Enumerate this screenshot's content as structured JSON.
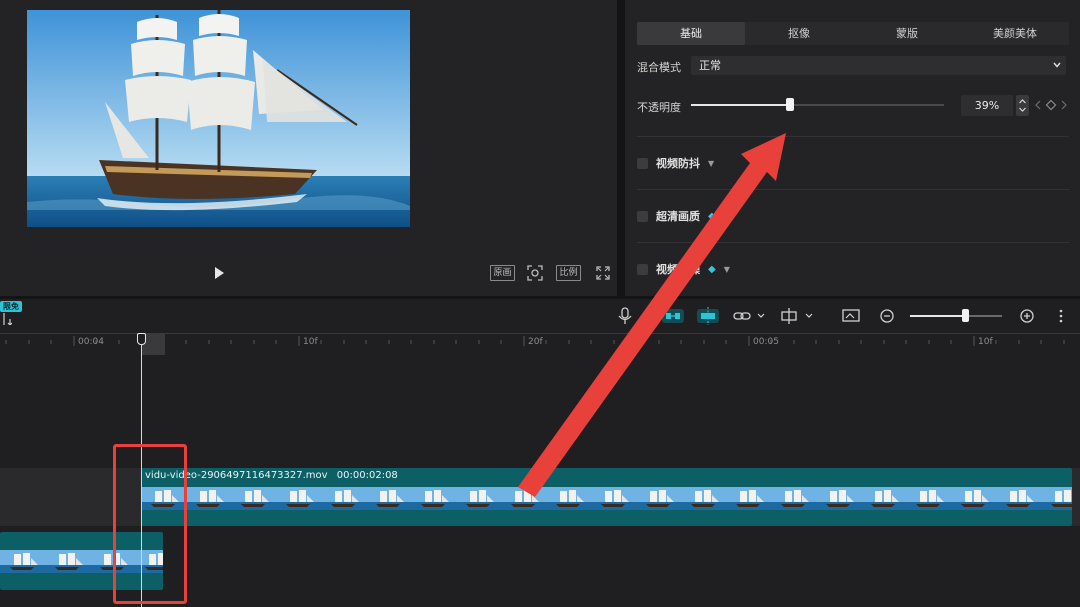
{
  "preview": {
    "controls": {
      "original_label": "原画",
      "ratio_label": "比例"
    }
  },
  "props": {
    "tabs": [
      {
        "label": "基础",
        "active": true
      },
      {
        "label": "抠像",
        "active": false
      },
      {
        "label": "蒙版",
        "active": false
      },
      {
        "label": "美颜美体",
        "active": false
      }
    ],
    "blend_mode": {
      "label": "混合模式",
      "value": "正常"
    },
    "opacity": {
      "label": "不透明度",
      "value": "39%",
      "level": 0.39
    },
    "options": [
      {
        "label": "视频防抖",
        "premium": false,
        "checked": false
      },
      {
        "label": "超清画质",
        "premium": true,
        "checked": false
      },
      {
        "label": "视频降噪",
        "premium": true,
        "checked": false
      }
    ]
  },
  "timeline": {
    "free_badge": "限免",
    "ruler": [
      "00:04",
      "10f",
      "20f",
      "00:05",
      "10f"
    ],
    "main_clip": {
      "filename": "vidu-video-2906497116473327.mov",
      "duration": "00:00:02:08"
    }
  },
  "colors": {
    "accent": "#2ec4d6",
    "clip": "#0c5f65",
    "annotation": "#e8403a"
  }
}
